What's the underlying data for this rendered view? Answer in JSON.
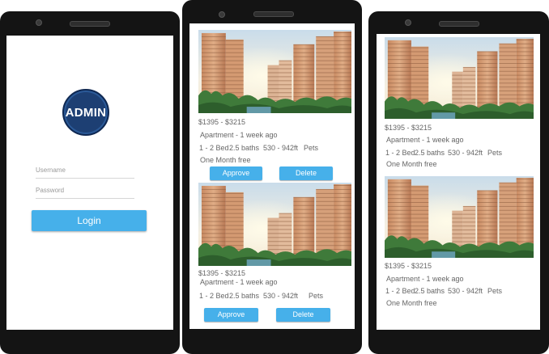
{
  "login": {
    "logo_text": "ADMIN",
    "username_placeholder": "Username",
    "password_placeholder": "Password",
    "login_label": "Login"
  },
  "listing": {
    "price": "$1395 - $3215",
    "type": "Apartment - 1 week ago",
    "beds": "1 - 2 Bed",
    "baths": "2.5 baths",
    "area": "530 - 942ft",
    "pets": "Pets",
    "offer": "One Month free"
  },
  "actions": {
    "approve_label": "Approve",
    "delete_label": "Delete"
  },
  "colors": {
    "accent": "#46b0ea",
    "logo_bg": "#1d3f73",
    "phone_frame": "#141414"
  }
}
